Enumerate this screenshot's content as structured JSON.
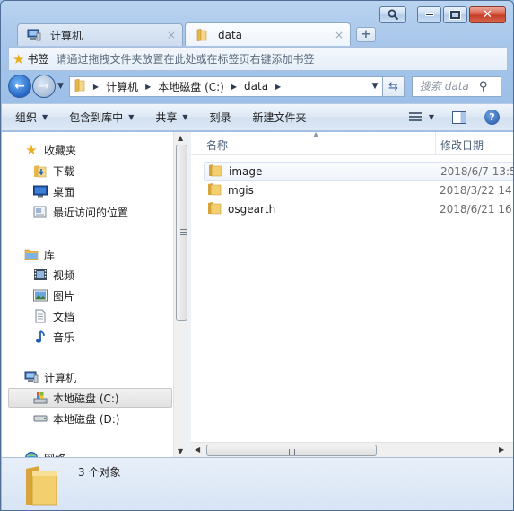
{
  "window": {
    "caption_buttons": [
      "search",
      "minimize",
      "maximize",
      "close"
    ]
  },
  "tabs": [
    {
      "label": "计算机",
      "icon": "computer-icon",
      "active": false
    },
    {
      "label": "data",
      "icon": "folder-icon",
      "active": true
    }
  ],
  "tab_close": "×",
  "new_tab": "+",
  "bookmarks": {
    "title": "书签",
    "hint": "请通过拖拽文件夹放置在此处或在标签页右键添加书签"
  },
  "address": {
    "crumbs": [
      "计算机",
      "本地磁盘 (C:)",
      "data"
    ]
  },
  "search": {
    "placeholder": "搜索 data"
  },
  "toolbar": {
    "organize": "组织",
    "include_in_library": "包含到库中",
    "share": "共享",
    "burn": "刻录",
    "new_folder": "新建文件夹"
  },
  "nav": {
    "favorites": "收藏夹",
    "downloads": "下载",
    "desktop": "桌面",
    "recent": "最近访问的位置",
    "libraries": "库",
    "videos": "视频",
    "pictures": "图片",
    "documents": "文档",
    "music": "音乐",
    "computer": "计算机",
    "drive_c": "本地磁盘 (C:)",
    "drive_d": "本地磁盘 (D:)",
    "network_partial": "网络"
  },
  "columns": {
    "name": "名称",
    "modified": "修改日期"
  },
  "files": [
    {
      "name": "image",
      "date": "2018/6/7 13:5"
    },
    {
      "name": "mgis",
      "date": "2018/3/22 14"
    },
    {
      "name": "osgearth",
      "date": "2018/6/21 16"
    }
  ],
  "details": {
    "count": "3 个对象"
  },
  "colors": {
    "folder": "#e8b94a",
    "accent": "#2566c4",
    "chrome": "#a7c6ea"
  }
}
